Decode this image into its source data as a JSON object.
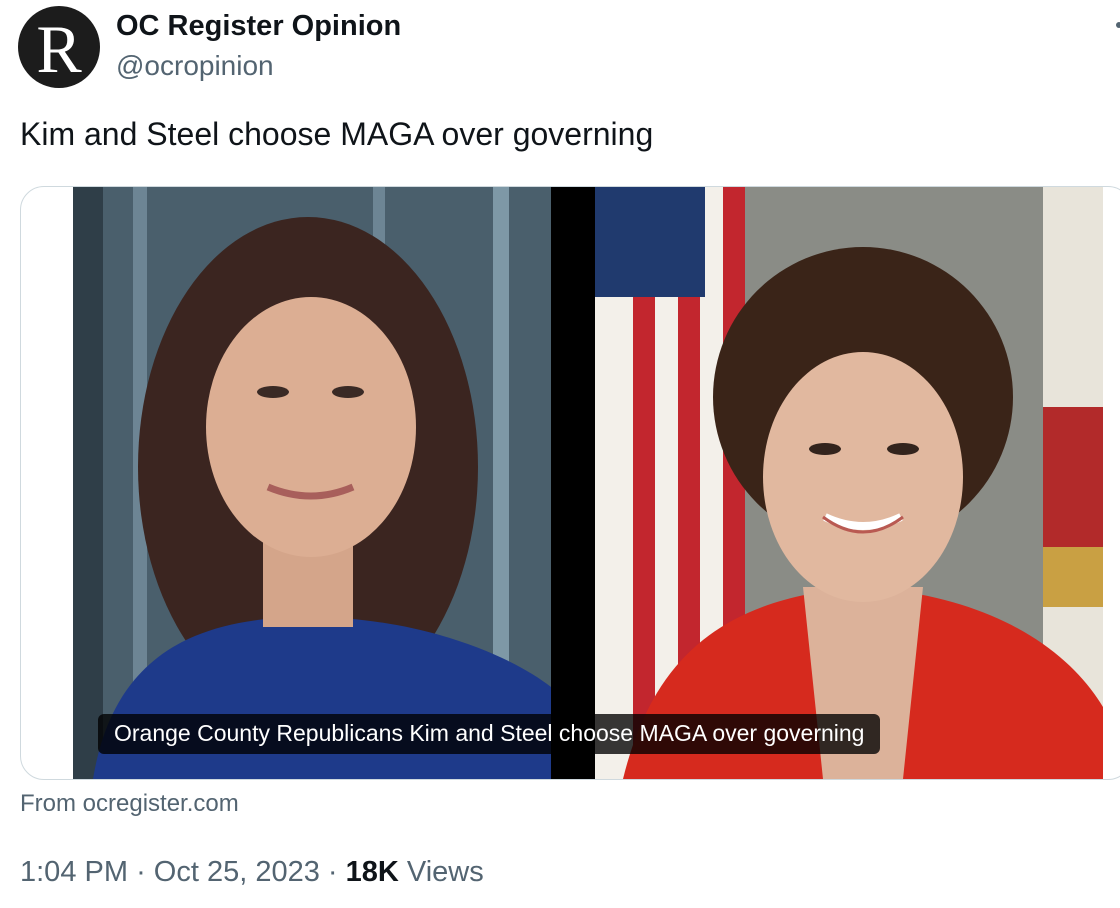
{
  "profile": {
    "avatar_letter": "R",
    "display_name": "OC Register Opinion",
    "handle": "@ocropinion"
  },
  "tweet": {
    "text": "Kim and Steel choose MAGA over governing"
  },
  "card": {
    "caption": "Orange County Republicans Kim and Steel choose MAGA over governing",
    "source": "From ocregister.com"
  },
  "meta": {
    "time": "1:04 PM",
    "separator": "·",
    "date": "Oct 25, 2023",
    "views_count": "18K",
    "views_label": "Views"
  },
  "icons": [
    "more-icon"
  ]
}
